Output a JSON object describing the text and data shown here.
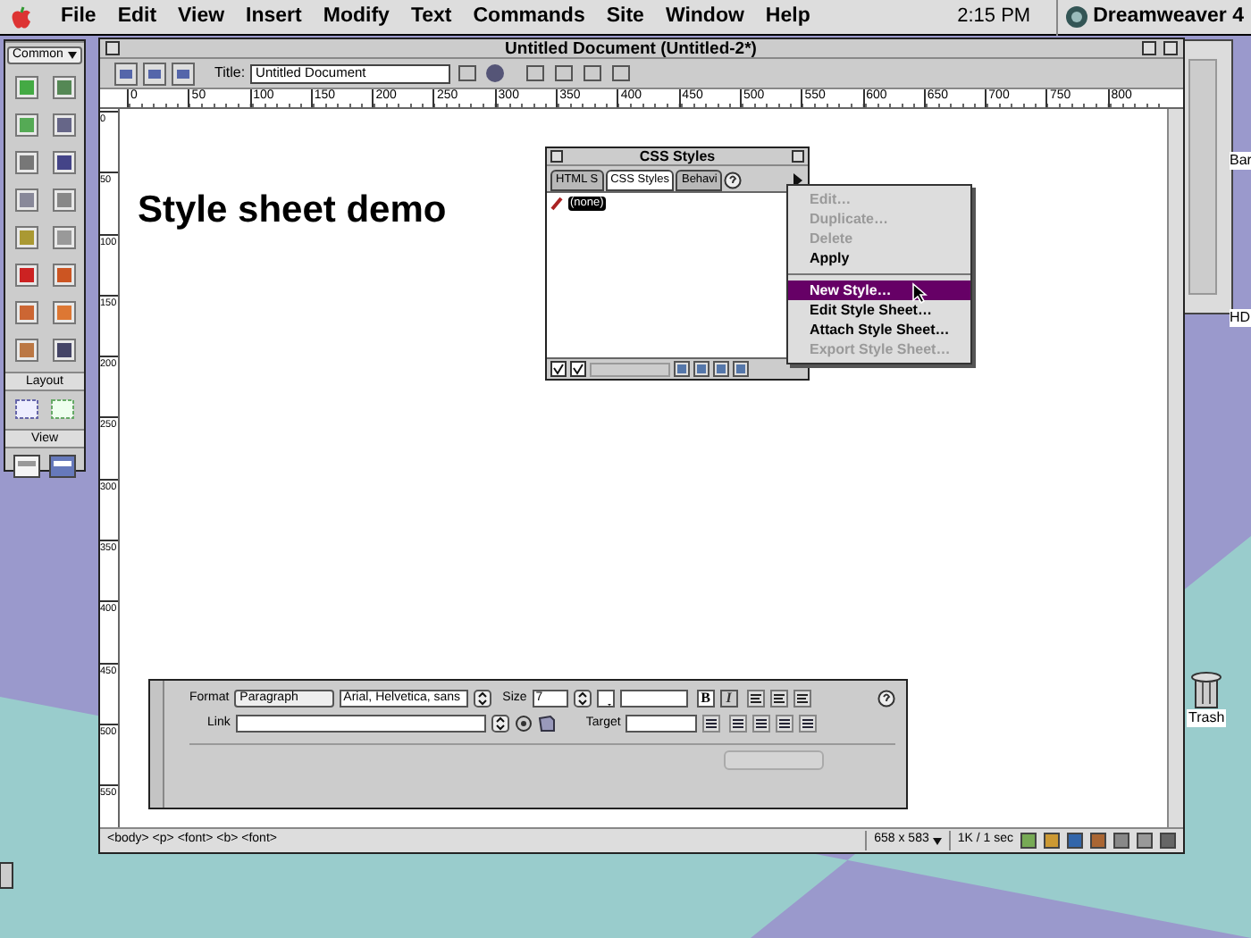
{
  "menu_bar": {
    "menus": [
      "File",
      "Edit",
      "View",
      "Insert",
      "Modify",
      "Text",
      "Commands",
      "Site",
      "Window",
      "Help"
    ],
    "time": "2:15 PM",
    "app": "Dreamweaver 4"
  },
  "objects_palette": {
    "category": "Common",
    "sections": [
      "Layout",
      "View"
    ],
    "view_buttons": [
      {
        "selected": false
      },
      {
        "selected": true
      }
    ]
  },
  "document_window": {
    "title": "Untitled Document (Untitled-2*)",
    "title_label": "Title:",
    "page_title": "Untitled Document",
    "ruler_marks": [
      "0",
      "50",
      "100",
      "150",
      "200",
      "250",
      "300",
      "350",
      "400",
      "450",
      "500",
      "550",
      "600",
      "650",
      "700",
      "750",
      "800"
    ],
    "vertical_ruler_marks": [
      "0",
      "50",
      "100",
      "150",
      "200",
      "250",
      "300",
      "350",
      "400",
      "450",
      "500",
      "550"
    ],
    "heading": "Style sheet demo",
    "status_bar": {
      "tag_selector": "<body> <p> <font> <b> <font>",
      "window_size": "658 x 583",
      "download": "1K / 1 sec"
    }
  },
  "css_styles_panel": {
    "title": "CSS Styles",
    "tabs": [
      {
        "label": "HTML S",
        "selected": false
      },
      {
        "label": "CSS Styles",
        "selected": true
      },
      {
        "label": "Behavi",
        "selected": false
      }
    ],
    "styles": [
      {
        "label": "(none)",
        "selected": true
      }
    ]
  },
  "context_menu": {
    "items": [
      {
        "kind": "item",
        "label": "Edit…",
        "disabled": true,
        "selected": false
      },
      {
        "kind": "item",
        "label": "Duplicate…",
        "disabled": true,
        "selected": false
      },
      {
        "kind": "item",
        "label": "Delete",
        "disabled": true,
        "selected": false
      },
      {
        "kind": "item",
        "label": "Apply",
        "disabled": false,
        "selected": false
      },
      {
        "kind": "separator"
      },
      {
        "kind": "item",
        "label": "New Style…",
        "disabled": false,
        "selected": true
      },
      {
        "kind": "item",
        "label": "Edit Style Sheet…",
        "disabled": false,
        "selected": false
      },
      {
        "kind": "item",
        "label": "Attach Style Sheet…",
        "disabled": false,
        "selected": false
      },
      {
        "kind": "item",
        "label": "Export Style Sheet…",
        "disabled": true,
        "selected": false
      }
    ]
  },
  "properties_panel": {
    "format_label": "Format",
    "format": "Paragraph",
    "font": "Arial, Helvetica, sans",
    "size_label": "Size",
    "size": "7",
    "link_label": "Link",
    "target_label": "Target",
    "bold_label": "B",
    "italic_label": "I",
    "bold": true,
    "italic": false
  },
  "desktop_icons": [
    {
      "label": "Bar"
    },
    {
      "label": "HD"
    }
  ],
  "trash": {
    "label": "Trash"
  }
}
